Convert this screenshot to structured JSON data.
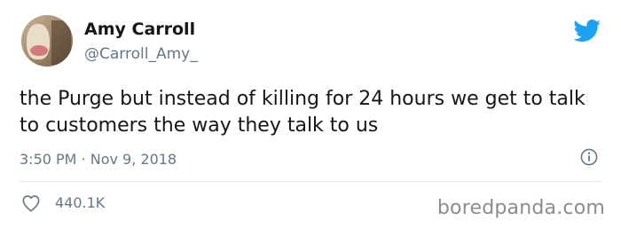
{
  "tweet": {
    "author_name": "Amy Carroll",
    "author_handle": "@Carroll_Amy_",
    "text": "the Purge but instead of killing for 24 hours we get to talk to customers the way they talk to us",
    "timestamp": "3:50 PM · Nov 9, 2018",
    "likes": "440.1K"
  },
  "watermark": "boredpanda.com",
  "icons": {
    "brand": "twitter-bird-icon",
    "info": "info-icon",
    "like": "heart-icon"
  },
  "colors": {
    "twitter_blue": "#1da1f2",
    "text_primary": "#14171a",
    "text_secondary": "#657786",
    "divider": "#e1e8ed"
  }
}
